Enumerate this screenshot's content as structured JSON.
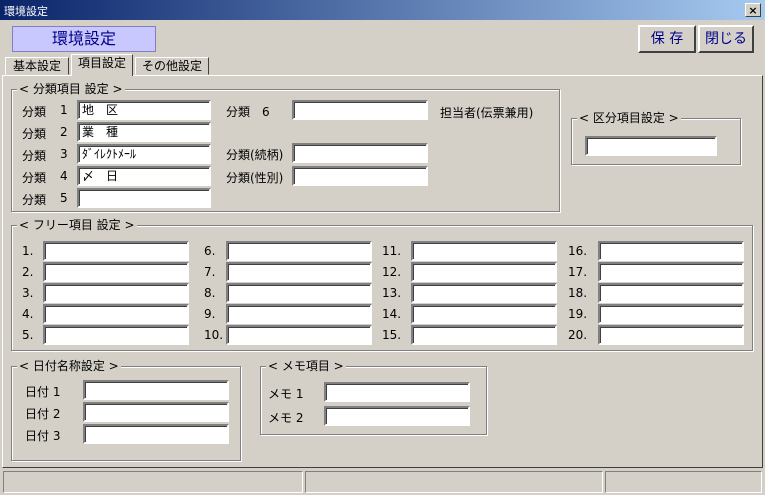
{
  "window": {
    "title": "環境設定",
    "close": "×"
  },
  "header": {
    "title": "環境設定",
    "save_label": "保 存",
    "close_label": "閉じる"
  },
  "tabs": [
    "基本設定",
    "項目設定",
    "その他設定"
  ],
  "groups": {
    "classification": "< 分類項目 設定 >",
    "division": "< 区分項目設定 >",
    "free": "< フリー項目 設定 >",
    "date": "< 日付名称設定 >",
    "memo": "< メモ項目 >"
  },
  "classification": {
    "rows": [
      {
        "label": "分類",
        "num": "1",
        "value": "地　区"
      },
      {
        "label": "分類",
        "num": "2",
        "value": "業　種"
      },
      {
        "label": "分類",
        "num": "3",
        "value": "ﾀﾞｲﾚｸﾄﾒｰﾙ"
      },
      {
        "label": "分類",
        "num": "4",
        "value": "〆　日"
      },
      {
        "label": "分類",
        "num": "5",
        "value": ""
      }
    ],
    "right_rows": [
      {
        "label": "分類　6",
        "value": ""
      },
      {
        "label": "分類(続柄)",
        "value": ""
      },
      {
        "label": "分類(性別)",
        "value": ""
      }
    ],
    "person_label": "担当者(伝票兼用)"
  },
  "division": {
    "value": ""
  },
  "free": {
    "labels": [
      "1.",
      "2.",
      "3.",
      "4.",
      "5.",
      "6.",
      "7.",
      "8.",
      "9.",
      "10.",
      "11.",
      "12.",
      "13.",
      "14.",
      "15.",
      "16.",
      "17.",
      "18.",
      "19.",
      "20."
    ],
    "values": [
      "",
      "",
      "",
      "",
      "",
      "",
      "",
      "",
      "",
      "",
      "",
      "",
      "",
      "",
      "",
      "",
      "",
      "",
      "",
      ""
    ]
  },
  "date": {
    "rows": [
      {
        "label": "日付 1",
        "value": ""
      },
      {
        "label": "日付 2",
        "value": ""
      },
      {
        "label": "日付 3",
        "value": ""
      }
    ]
  },
  "memo": {
    "rows": [
      {
        "label": "メモ 1",
        "value": ""
      },
      {
        "label": "メモ 2",
        "value": ""
      }
    ]
  }
}
